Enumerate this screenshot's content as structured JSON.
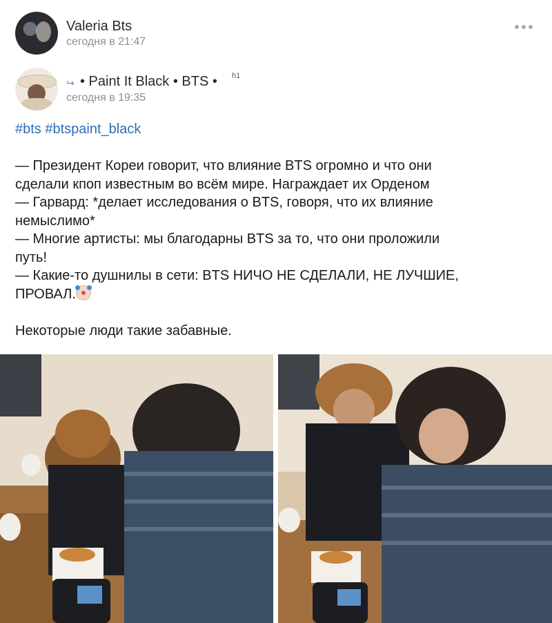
{
  "post": {
    "author": "Valeria Bts",
    "time": "сегодня в 21:47",
    "menu_icon": "more-dots-icon"
  },
  "repost": {
    "source": "• Paint It Black • BTS •",
    "badge": "h1",
    "time": "сегодня в 19:35",
    "repost_icon": "repost-arrow-icon"
  },
  "text": {
    "hashtags": [
      "#bts",
      "#btspaint_black"
    ],
    "lines": [
      "— Президент Кореи говорит, что влияние BTS огромно и что они",
      "сделали кпоп известным во всём мире. Награждает их Орденом",
      "— Гарвард: *делает исследования о BTS, говоря, что их влияние",
      "немыслимо*",
      "— Многие артисты: мы благодарны BTS за то, что они проложили",
      "путь!",
      "— Какие-то душнилы в сети: BTS НИЧО НЕ СДЕЛАЛИ, НЕ ЛУЧШИЕ,",
      "ПРОВАЛ."
    ],
    "closing": "Некоторые люди такие забавные."
  },
  "colors": {
    "link": "#2a6fb7",
    "meta": "#8a8f96",
    "text": "#1a1a1a"
  }
}
